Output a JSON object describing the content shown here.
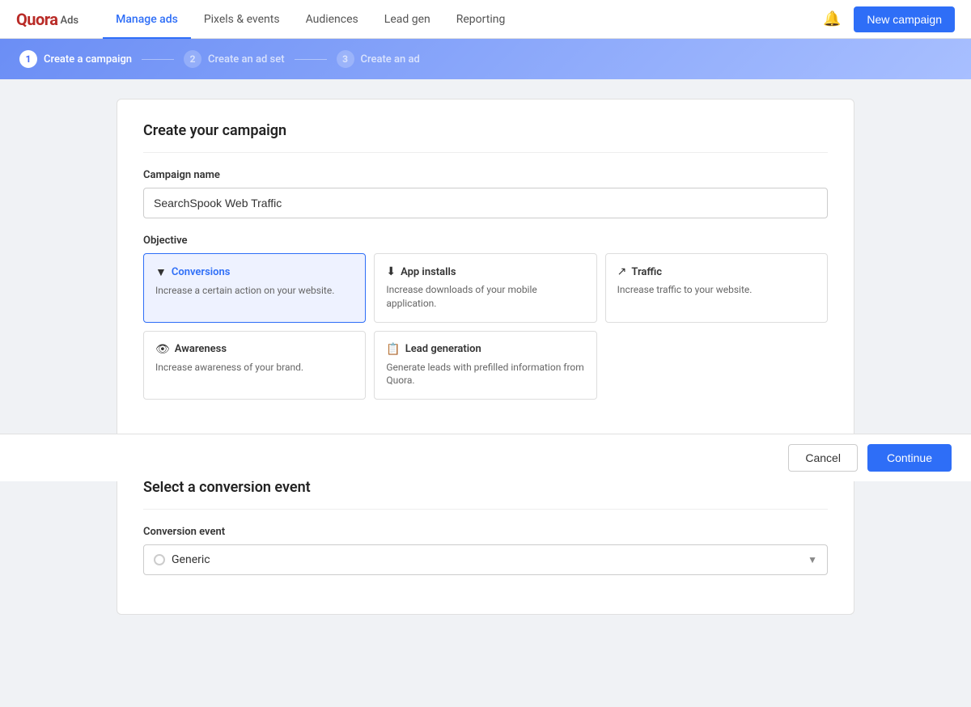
{
  "brand": {
    "logo_quora": "Quora",
    "logo_ads": "Ads"
  },
  "navbar": {
    "items": [
      {
        "label": "Manage ads",
        "active": true
      },
      {
        "label": "Pixels & events",
        "active": false
      },
      {
        "label": "Audiences",
        "active": false
      },
      {
        "label": "Lead gen",
        "active": false
      },
      {
        "label": "Reporting",
        "active": false
      }
    ],
    "new_campaign_label": "New campaign"
  },
  "stepper": {
    "steps": [
      {
        "num": "1",
        "label": "Create a campaign",
        "active": true
      },
      {
        "num": "2",
        "label": "Create an ad set",
        "active": false
      },
      {
        "num": "3",
        "label": "Create an ad",
        "active": false
      }
    ]
  },
  "create_campaign": {
    "title": "Create your campaign",
    "campaign_name_label": "Campaign name",
    "campaign_name_value": "SearchSpook Web Traffic",
    "objective_label": "Objective",
    "objectives": [
      {
        "id": "conversions",
        "icon": "▼",
        "title": "Conversions",
        "description": "Increase a certain action on your website.",
        "selected": true
      },
      {
        "id": "app-installs",
        "icon": "⬇",
        "title": "App installs",
        "description": "Increase downloads of your mobile application.",
        "selected": false
      },
      {
        "id": "traffic",
        "icon": "↗",
        "title": "Traffic",
        "description": "Increase traffic to your website.",
        "selected": false
      },
      {
        "id": "awareness",
        "icon": "👁",
        "title": "Awareness",
        "description": "Increase awareness of your brand.",
        "selected": false
      },
      {
        "id": "lead-generation",
        "icon": "📋",
        "title": "Lead generation",
        "description": "Generate leads with prefilled information from Quora.",
        "selected": false
      }
    ]
  },
  "conversion_event": {
    "title": "Select a conversion event",
    "label": "Conversion event",
    "value": "Generic",
    "placeholder": "Generic"
  },
  "footer": {
    "cancel_label": "Cancel",
    "continue_label": "Continue"
  }
}
